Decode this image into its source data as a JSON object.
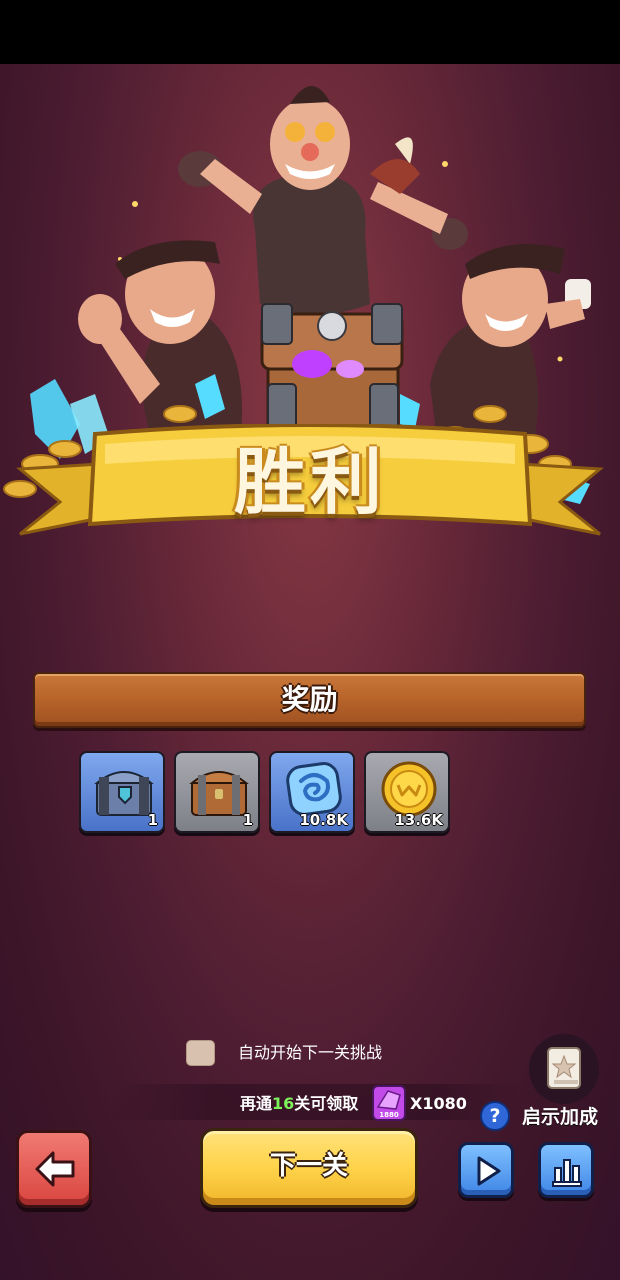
{
  "banner": {
    "title": "胜利"
  },
  "rewards_section": {
    "label": "奖励"
  },
  "rewards": [
    {
      "item": "iron-chest-icon",
      "count": "1"
    },
    {
      "item": "wooden-chest-icon",
      "count": "1"
    },
    {
      "item": "stone-rune-icon",
      "count": "10.8K"
    },
    {
      "item": "gold-coin-icon",
      "count": "13.6K"
    }
  ],
  "auto_start": {
    "label": "自动开始下一关挑战",
    "checked": false
  },
  "progress": {
    "prefix": "再通",
    "levels": "16",
    "suffix": "关可领取",
    "gem_label": "1880",
    "multiplier": "X1080"
  },
  "boost": {
    "label": "启示加成",
    "help": "?"
  },
  "next_button": {
    "label": "下一关"
  },
  "colors": {
    "background": "#4e1d32",
    "next_button": "#ffd34a",
    "back_button": "#e25a52",
    "blue_button": "#4f95ee",
    "progress_highlight": "#7df25a"
  }
}
